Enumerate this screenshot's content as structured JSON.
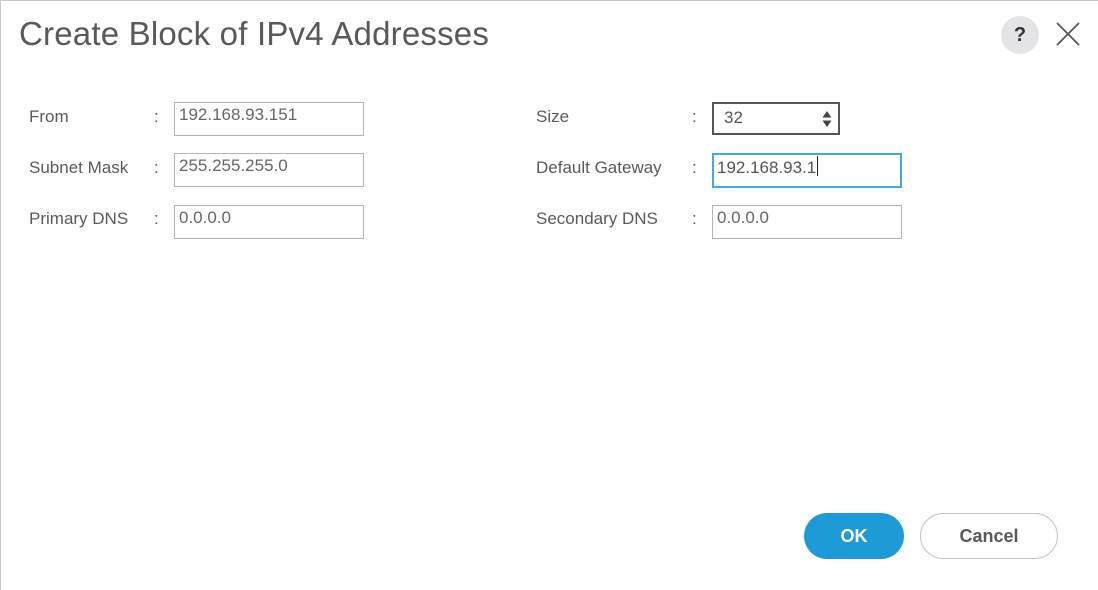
{
  "dialog": {
    "title": "Create Block of IPv4 Addresses",
    "help_icon": "question-mark-icon",
    "help_label": "?",
    "close_icon": "close-x-icon"
  },
  "form": {
    "from": {
      "label": "From",
      "colon": ":",
      "value": "192.168.93.151"
    },
    "subnet_mask": {
      "label": "Subnet Mask",
      "colon": ":",
      "value": "255.255.255.0"
    },
    "primary_dns": {
      "label": "Primary DNS",
      "colon": ":",
      "value": "0.0.0.0"
    },
    "size": {
      "label": "Size",
      "colon": ":",
      "value": "32"
    },
    "default_gateway": {
      "label": "Default Gateway",
      "colon": ":",
      "value": "192.168.93.1"
    },
    "secondary_dns": {
      "label": "Secondary DNS",
      "colon": ":",
      "value": "0.0.0.0"
    }
  },
  "buttons": {
    "ok": "OK",
    "cancel": "Cancel"
  },
  "colors": {
    "primary": "#1e9ad6",
    "focus_border": "#49a9d6",
    "title_text": "#58595b"
  }
}
